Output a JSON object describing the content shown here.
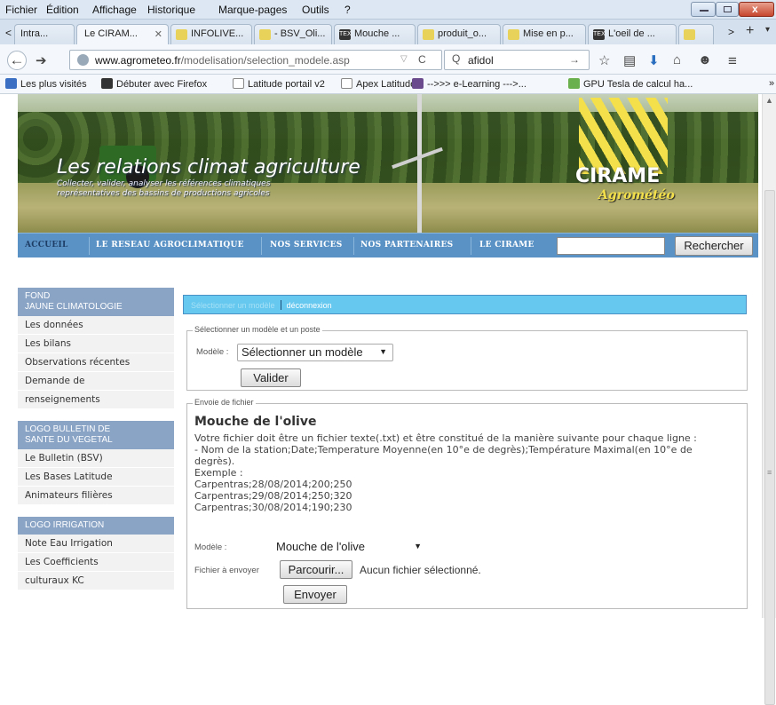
{
  "browser": {
    "menu": [
      "Fichier",
      "Édition",
      "Affichage",
      "Historique",
      "Marque-pages",
      "Outils",
      "?"
    ],
    "tabs": [
      {
        "label": "Intra...",
        "active": false
      },
      {
        "label": "Le CIRAM...",
        "active": true
      },
      {
        "label": "INFOLIVE...",
        "active": false
      },
      {
        "label": "- BSV_Oli...",
        "active": false
      },
      {
        "label": "Mouche ...",
        "active": false
      },
      {
        "label": "produit_o...",
        "active": false
      },
      {
        "label": "Mise en p...",
        "active": false
      },
      {
        "label": "L'oeil de ...",
        "active": false
      }
    ],
    "url_host": "www.agrometeo.fr",
    "url_path": "/modelisation/selection_modele.asp",
    "search_value": "afidol",
    "bookmarks": [
      "Les plus visités",
      "Débuter avec Firefox",
      "Latitude portail v2",
      "Apex Latitude",
      "-->>> e-Learning --->...",
      "GPU Tesla de calcul ha..."
    ]
  },
  "banner": {
    "title": "Les relations climat agriculture",
    "subtitle_1": "Collecter, valider, analyser les références climatiques",
    "subtitle_2": "représentatives des bassins de productions agricoles",
    "logo_main": "CIRAME",
    "logo_sub": "Agrométéo"
  },
  "nav": {
    "items": [
      "ACCUEIL",
      "LE RESEAU AGROCLIMATIQUE",
      "NOS SERVICES",
      "NOS PARTENAIRES",
      "LE CIRAME"
    ],
    "search_button": "Rechercher"
  },
  "sidebar": {
    "sections": [
      {
        "heading_1": "FOND",
        "heading_2": "JAUNE CLIMATOLOGIE",
        "items": [
          "Les données",
          "Les bilans",
          "Observations récentes",
          "Demande de",
          "renseignements"
        ]
      },
      {
        "heading_1": "LOGO BULLETIN DE",
        "heading_2": "SANTE DU VEGETAL",
        "items": [
          "Le Bulletin (BSV)",
          "Les Bases Latitude",
          "Animateurs filières"
        ]
      },
      {
        "heading_1": "LOGO IRRIGATION",
        "heading_2": "",
        "items": [
          "Note Eau Irrigation",
          "Les Coefficients",
          "culturaux KC"
        ]
      }
    ]
  },
  "content": {
    "topbar_link_1": "Sélectionner un modèle",
    "topbar_link_2": "déconnexion",
    "select_legend": "Sélectionner un modèle et un poste",
    "model_label": "Modèle :",
    "model_value": "Sélectionner un modèle",
    "validate_button": "Valider",
    "upload_legend": "Envoie de fichier",
    "upload_title": "Mouche de l'olive",
    "upload_text_1": "Votre fichier doit être un fichier texte(.txt) et être constitué de la manière suivante pour chaque ligne :",
    "upload_text_2": "- Nom de la station;Date;Temperature Moyenne(en 10°e de degrès);Température Maximal(en 10°e de",
    "upload_text_3": "degrès).",
    "example_label": "Exemple :",
    "example_lines": [
      "Carpentras;28/08/2014;200;250",
      "Carpentras;29/08/2014;250;320",
      "Carpentras;30/08/2014;190;230"
    ],
    "model2_label": "Modèle :",
    "model2_value": "Mouche de l'olive",
    "file_label": "Fichier à envoyer",
    "browse_button": "Parcourir...",
    "no_file": "Aucun fichier sélectionné.",
    "send_button": "Envoyer"
  },
  "colors": {
    "nav_bg": "#5a92c5",
    "sidebar_heading": "#8aa4c6",
    "topbar_bg": "#66c8ef",
    "logo_yellow": "#f3e04a"
  }
}
